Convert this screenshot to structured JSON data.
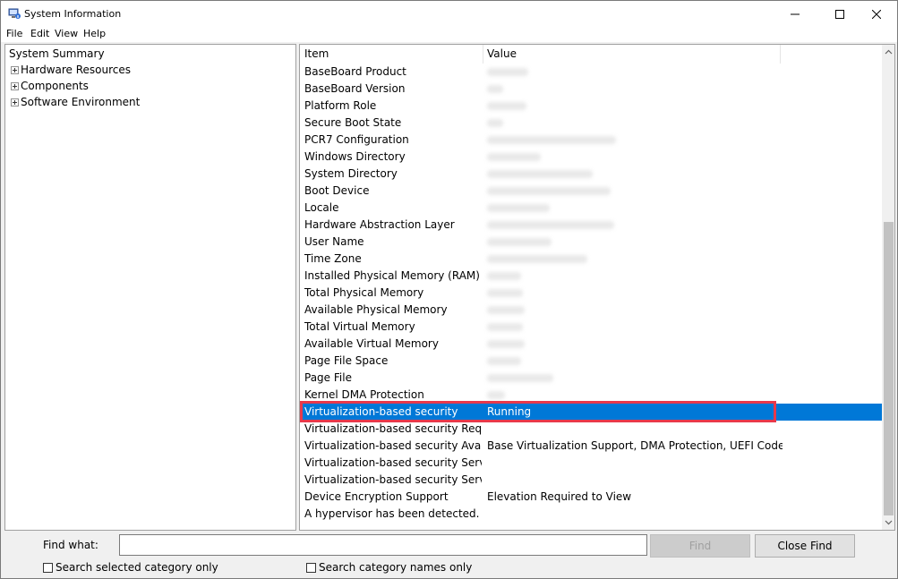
{
  "window": {
    "title": "System Information"
  },
  "menu": [
    "File",
    "Edit",
    "View",
    "Help"
  ],
  "tree": {
    "summary": "System Summary",
    "items": [
      "Hardware Resources",
      "Components",
      "Software Environment"
    ]
  },
  "list": {
    "columns": {
      "item": "Item",
      "value": "Value"
    },
    "rows": [
      {
        "item": "BaseBoard Product",
        "value": ""
      },
      {
        "item": "BaseBoard Version",
        "value": ""
      },
      {
        "item": "Platform Role",
        "value": ""
      },
      {
        "item": "Secure Boot State",
        "value": ""
      },
      {
        "item": "PCR7 Configuration",
        "value": ""
      },
      {
        "item": "Windows Directory",
        "value": ""
      },
      {
        "item": "System Directory",
        "value": ""
      },
      {
        "item": "Boot Device",
        "value": ""
      },
      {
        "item": "Locale",
        "value": ""
      },
      {
        "item": "Hardware Abstraction Layer",
        "value": ""
      },
      {
        "item": "User Name",
        "value": ""
      },
      {
        "item": "Time Zone",
        "value": ""
      },
      {
        "item": "Installed Physical Memory (RAM)",
        "value": ""
      },
      {
        "item": "Total Physical Memory",
        "value": ""
      },
      {
        "item": "Available Physical Memory",
        "value": ""
      },
      {
        "item": "Total Virtual Memory",
        "value": ""
      },
      {
        "item": "Available Virtual Memory",
        "value": ""
      },
      {
        "item": "Page File Space",
        "value": ""
      },
      {
        "item": "Page File",
        "value": ""
      },
      {
        "item": "Kernel DMA Protection",
        "value": ""
      },
      {
        "item": "Virtualization-based security",
        "value": "Running"
      },
      {
        "item": "Virtualization-based security Requir...",
        "value": ""
      },
      {
        "item": "Virtualization-based security Availa...",
        "value": "Base Virtualization Support, DMA Protection, UEFI Code Re..."
      },
      {
        "item": "Virtualization-based security Servic...",
        "value": ""
      },
      {
        "item": "Virtualization-based security Servic...",
        "value": ""
      },
      {
        "item": "Device Encryption Support",
        "value": "Elevation Required to View"
      },
      {
        "item": "A hypervisor has been detected. Fe...",
        "value": ""
      }
    ],
    "selected_index": 20
  },
  "find": {
    "label": "Find what:",
    "value": "",
    "find_button": "Find",
    "close_button": "Close Find",
    "search_selected": "Search selected category only",
    "search_names": "Search category names only"
  },
  "colors": {
    "selection": "#0078d7",
    "highlight_border": "#e8394b"
  }
}
